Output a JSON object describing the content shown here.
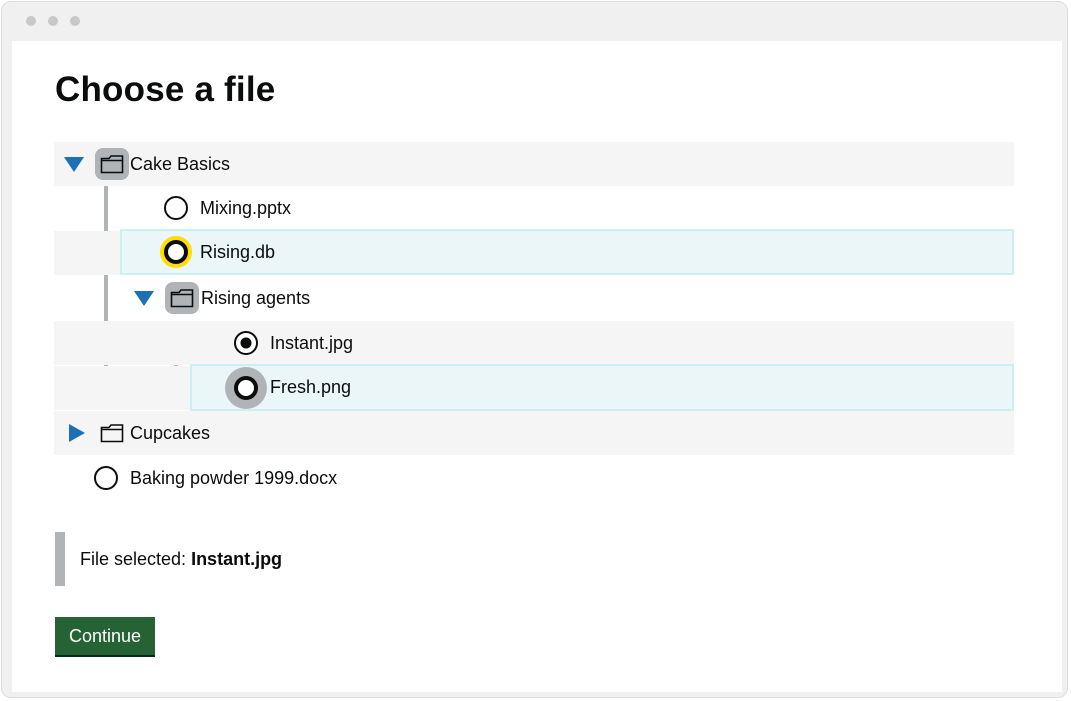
{
  "page_title": "Choose a file",
  "tree": {
    "cake_basics": {
      "label": "Cake Basics",
      "expanded": true,
      "icon": "folder-icon"
    },
    "mixing": {
      "label": "Mixing.pptx",
      "checked": false
    },
    "rising_db": {
      "label": "Rising.db",
      "checked": false
    },
    "rising_agents": {
      "label": "Rising agents",
      "expanded": true,
      "icon": "folder-icon"
    },
    "instant": {
      "label": "Instant.jpg",
      "checked": true
    },
    "fresh": {
      "label": "Fresh.png",
      "checked": false
    },
    "cupcakes": {
      "label": "Cupcakes",
      "expanded": false,
      "icon": "folder-icon"
    },
    "baking_powder": {
      "label": "Baking powder 1999.docx",
      "checked": false
    }
  },
  "selection": {
    "prefix": "File selected:",
    "value": "Instant.jpg"
  },
  "continue_button": {
    "label": "Continue"
  },
  "colors": {
    "caret": "#1d70b8",
    "focus": "#ffdd00",
    "highlight_row": "#eaf6f7",
    "button": "#256335"
  }
}
